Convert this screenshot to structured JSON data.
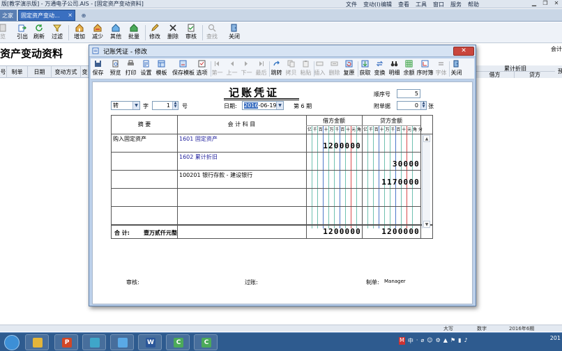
{
  "app": {
    "title": "版[教学演示版] - 万通电子公司.AIS - [固定资产变动资料]",
    "menu": [
      "文件(F)",
      "变动(I)",
      "编辑(E)",
      "查看(V)",
      "工具(T)",
      "窗口(W)",
      "服务(S)",
      "帮助(H)"
    ],
    "window_controls": [
      "▁",
      "❐",
      "✕"
    ]
  },
  "tabs": {
    "home": "之家",
    "active": "固定资产变动...",
    "active_close": "×",
    "new": "⊕"
  },
  "toolbar": [
    "览",
    "引出",
    "刷新",
    "过滤",
    "增加",
    "减少",
    "其他",
    "批量",
    "修改",
    "删除",
    "审核",
    "查找",
    "关闭"
  ],
  "page": {
    "title": "资产变动资料",
    "right_label": "会计",
    "depreciation_header": "累计折旧"
  },
  "grid_columns": [
    "号",
    "制单",
    "日期",
    "变动方式",
    "变"
  ],
  "grid_right_columns": [
    "借方",
    "贷方",
    "预"
  ],
  "dialog": {
    "title": "记账凭证 - 修改",
    "close": "✕",
    "toolbar": [
      "保存",
      "预览",
      "打印",
      "设置",
      "模板",
      "保存模板",
      "选项",
      "第一",
      "上一",
      "下一",
      "最后",
      "跳转",
      "拷贝",
      "粘贴",
      "插入",
      "删除",
      "复原",
      "获取",
      "变换",
      "明细",
      "余额",
      "序时簿",
      "字体",
      "关闭"
    ]
  },
  "voucher": {
    "title": "记账凭证",
    "word_label": "字",
    "word_value": "转",
    "number_value": "1",
    "number_label": "号",
    "date_label": "日期:",
    "date_year": "2016",
    "date_rest": "-06-19",
    "period": "第 6 期",
    "seq_label": "顺序号",
    "seq_value": "5",
    "attach_label": "附单据",
    "attach_value": "0",
    "attach_unit": "张",
    "headers": {
      "summary": "摘    要",
      "account": "会  计  科  目",
      "debit": "借方金额",
      "credit": "贷方金额"
    },
    "digit_labels": [
      "亿",
      "千",
      "百",
      "十",
      "万",
      "千",
      "百",
      "十",
      "元",
      "角",
      "分"
    ],
    "rows": [
      {
        "summary": "购入固定资产",
        "code": "1601",
        "account": "固定资产",
        "debit": "1200000",
        "credit": ""
      },
      {
        "summary": "",
        "code": "1602",
        "account": "累计折旧",
        "debit": "",
        "credit": "30000"
      },
      {
        "summary": "",
        "code": "100201",
        "account": "银行存款 - 建设银行",
        "debit": "",
        "credit": "1170000"
      },
      {
        "summary": "",
        "code": "",
        "account": "",
        "debit": "",
        "credit": ""
      },
      {
        "summary": "",
        "code": "",
        "account": "",
        "debit": "",
        "credit": ""
      }
    ],
    "total_label": "合  计:",
    "total_words": "壹万贰仟元整",
    "total_debit": "1200000",
    "total_credit": "1200000",
    "footer": {
      "review": "审核:",
      "post": "过账:",
      "maker_label": "制单:",
      "maker": "Manager"
    }
  },
  "statusbar": {
    "caps": "大写",
    "num": "数字",
    "period": "2016年6期"
  },
  "taskbar": {
    "apps": [
      "",
      "P",
      "",
      "",
      "W",
      "C",
      "C"
    ],
    "tray": [
      "M",
      "中",
      "·",
      "⌀",
      "☺",
      "⚙",
      "▲",
      "⚑",
      "▮",
      "♪"
    ],
    "clock": "201"
  }
}
